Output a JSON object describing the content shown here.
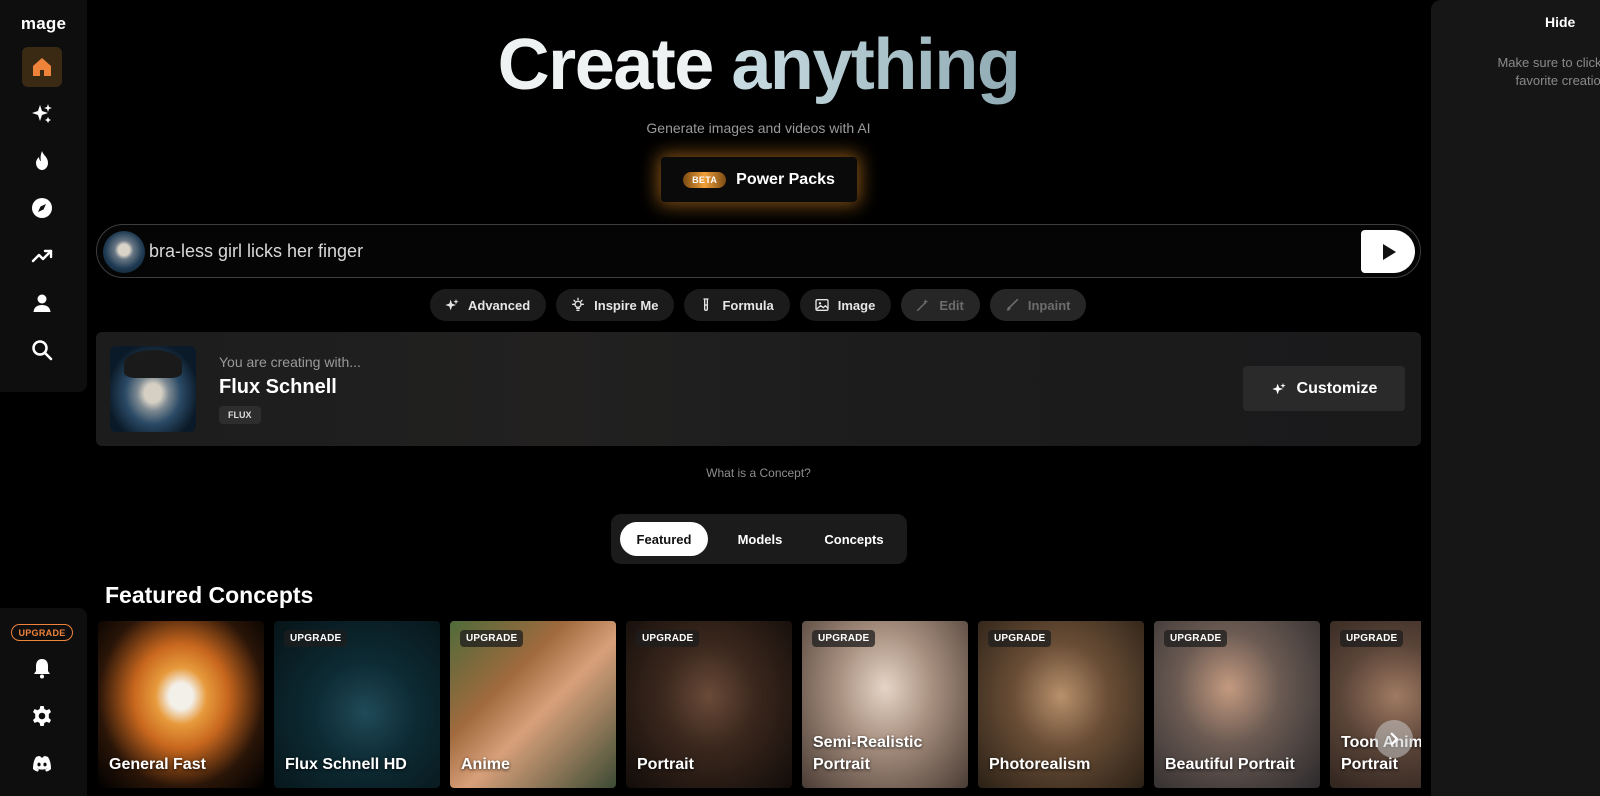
{
  "app": {
    "logo": "mage"
  },
  "sidebar": {
    "items": [
      {
        "name": "home",
        "icon": "home-icon",
        "active": true
      },
      {
        "name": "create",
        "icon": "sparkles-icon"
      },
      {
        "name": "hot",
        "icon": "flame-icon"
      },
      {
        "name": "explore",
        "icon": "compass-icon"
      },
      {
        "name": "trending",
        "icon": "trending-icon"
      },
      {
        "name": "profile",
        "icon": "user-icon"
      },
      {
        "name": "search",
        "icon": "search-icon"
      }
    ],
    "upgrade_label": "UPGRADE",
    "bottom_items": [
      {
        "name": "notifications",
        "icon": "bell-icon"
      },
      {
        "name": "settings",
        "icon": "gear-icon"
      },
      {
        "name": "discord",
        "icon": "discord-icon"
      }
    ]
  },
  "hero": {
    "title_word1": "Create",
    "title_word2": "anything",
    "subtitle": "Generate images and videos with AI",
    "power_badge": "BETA",
    "power_label": "Power Packs"
  },
  "prompt": {
    "value": "bra-less girl licks her finger",
    "send_icon": "play-icon"
  },
  "chips": [
    {
      "label": "Advanced",
      "icon": "sparkles-icon",
      "disabled": false
    },
    {
      "label": "Inspire Me",
      "icon": "lightbulb-icon",
      "disabled": false
    },
    {
      "label": "Formula",
      "icon": "test-tube-icon",
      "disabled": false
    },
    {
      "label": "Image",
      "icon": "image-icon",
      "disabled": false
    },
    {
      "label": "Edit",
      "icon": "magic-wand-icon",
      "disabled": true
    },
    {
      "label": "Inpaint",
      "icon": "brush-icon",
      "disabled": true
    }
  ],
  "model": {
    "creating_with": "You are creating with...",
    "name": "Flux Schnell",
    "tag": "FLUX",
    "customize_label": "Customize"
  },
  "concept_question": "What is a Concept?",
  "tabs": [
    {
      "label": "Featured",
      "active": true
    },
    {
      "label": "Models",
      "active": false
    },
    {
      "label": "Concepts",
      "active": false
    }
  ],
  "featured": {
    "title": "Featured Concepts",
    "cards": [
      {
        "label": "General Fast",
        "upgrade": ""
      },
      {
        "label": "Flux Schnell HD",
        "upgrade": "UPGRADE"
      },
      {
        "label": "Anime",
        "upgrade": "UPGRADE"
      },
      {
        "label": "Portrait",
        "upgrade": "UPGRADE"
      },
      {
        "label": "Semi-Realistic Portrait",
        "upgrade": "UPGRADE"
      },
      {
        "label": "Photorealism",
        "upgrade": "UPGRADE"
      },
      {
        "label": "Beautiful Portrait",
        "upgrade": "UPGRADE"
      },
      {
        "label": "Toon Anim Portrait",
        "upgrade": "UPGRADE"
      }
    ]
  },
  "right_panel": {
    "hide_label": "Hide",
    "note_line1": "Make sure to click save",
    "note_line2": "favorite creations"
  },
  "colors": {
    "accent_orange": "#f0833a",
    "home_active_bg": "#3a2a14",
    "panel_bg": "#161617"
  }
}
